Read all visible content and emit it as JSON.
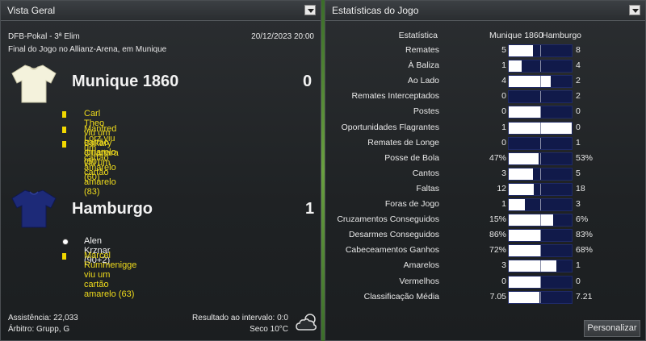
{
  "overview": {
    "title": "Vista Geral",
    "competition": "DFB-Pokal - 3ª Elim",
    "datetime": "20/12/2023 20:00",
    "venue": "Final do Jogo no Allianz-Arena, em Munique",
    "home": {
      "name": "Munique 1860",
      "score": "0",
      "shirt_color": "#f4f2dc",
      "events": [
        {
          "type": "yellow-card",
          "text": "Carl Theo viu um cartão amarelo (50)"
        },
        {
          "type": "yellow-card",
          "text": "Manfred Lorz viu um cartão amarelo (60)"
        },
        {
          "type": "yellow-card",
          "text": "Bakary Ouattara viu um cartão amarelo (83)"
        }
      ]
    },
    "away": {
      "name": "Hamburgo",
      "score": "1",
      "shirt_color": "#1d2a78",
      "events": [
        {
          "type": "goal",
          "text": "Alen Krznar (90+2)"
        },
        {
          "type": "yellow-card",
          "text": "Marcel Rummenigge viu um cartão amarelo (63)"
        }
      ]
    },
    "attendance": "Assistência: 22,033",
    "referee": "Árbitro: Grupp, G",
    "halftime": "Resultado ao intervalo: 0:0",
    "weather": "Seco 10°C",
    "weather_icon": "cloud-sun-icon"
  },
  "stats": {
    "title": "Estatísticas do Jogo",
    "header_label": "Estatística",
    "home_team": "Munique 1860",
    "away_team": "Hamburgo",
    "rows": [
      {
        "label": "Remates",
        "home": "5",
        "away": "8",
        "home_share": 0.38
      },
      {
        "label": "À Baliza",
        "home": "1",
        "away": "4",
        "home_share": 0.2
      },
      {
        "label": "Ao Lado",
        "home": "4",
        "away": "2",
        "home_share": 0.67
      },
      {
        "label": "Remates Interceptados",
        "home": "0",
        "away": "2",
        "home_share": 0.0
      },
      {
        "label": "Postes",
        "home": "0",
        "away": "0",
        "home_share": 0.5
      },
      {
        "label": "Oportunidades Flagrantes",
        "home": "1",
        "away": "0",
        "home_share": 1.0
      },
      {
        "label": "Remates de Longe",
        "home": "0",
        "away": "1",
        "home_share": 0.0
      },
      {
        "label": "Posse de Bola",
        "home": "47%",
        "away": "53%",
        "home_share": 0.47
      },
      {
        "label": "Cantos",
        "home": "3",
        "away": "5",
        "home_share": 0.38
      },
      {
        "label": "Faltas",
        "home": "12",
        "away": "18",
        "home_share": 0.4
      },
      {
        "label": "Foras de Jogo",
        "home": "1",
        "away": "3",
        "home_share": 0.25
      },
      {
        "label": "Cruzamentos Conseguidos",
        "home": "15%",
        "away": "6%",
        "home_share": 0.71
      },
      {
        "label": "Desarmes Conseguidos",
        "home": "86%",
        "away": "83%",
        "home_share": 0.51
      },
      {
        "label": "Cabeceamentos Ganhos",
        "home": "72%",
        "away": "68%",
        "home_share": 0.51
      },
      {
        "label": "Amarelos",
        "home": "3",
        "away": "1",
        "home_share": 0.75
      },
      {
        "label": "Vermelhos",
        "home": "0",
        "away": "0",
        "home_share": 0.5
      },
      {
        "label": "Classificação Média",
        "home": "7.05",
        "away": "7.21",
        "home_share": 0.49
      }
    ],
    "customize_label": "Personalizar"
  },
  "colors": {
    "bar_home": "#ffffff",
    "bar_away": "#111a4a",
    "card_yellow": "#f2d800",
    "event_text_yellow": "#f0dc1c"
  }
}
